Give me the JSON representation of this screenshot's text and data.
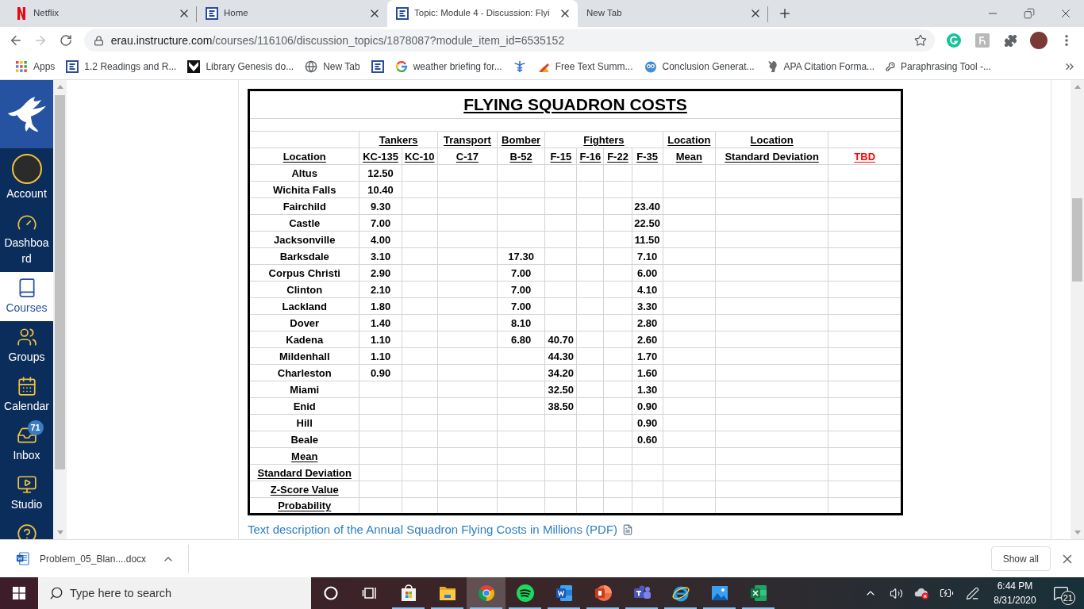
{
  "browser": {
    "tabs": [
      {
        "kind": "ribbon",
        "title": "Netflix",
        "selected": false
      },
      {
        "kind": "tile",
        "title": "Home",
        "selected": false
      },
      {
        "kind": "tile",
        "title": "Topic: Module 4 - Discussion: Flyi",
        "selected": true
      },
      {
        "kind": "blank",
        "title": "New Tab",
        "selected": false
      }
    ],
    "toolbar": {
      "back": {
        "disabled": false
      },
      "forward": {
        "disabled": true
      },
      "url_host": "erau.instructure.com",
      "url_path": "/courses/116106/discussion_topics/1878087?module_item_id=6535152"
    },
    "bookmarks": [
      {
        "kind": "apps",
        "label": "Apps"
      },
      {
        "kind": "tile",
        "label": "1.2 Readings and R..."
      },
      {
        "kind": "notch",
        "label": "Library Genesis do..."
      },
      {
        "kind": "globe",
        "label": "New Tab"
      },
      {
        "kind": "tile"
      },
      {
        "kind": "ring",
        "label": "weather briefing for..."
      },
      {
        "kind": "staff"
      },
      {
        "kind": "pencil",
        "label": "Free Text Summ..."
      },
      {
        "kind": "owl",
        "label": "Conclusion Generat..."
      },
      {
        "kind": "squirrel",
        "label": "APA Citation Forma..."
      },
      {
        "kind": "key",
        "label": "Paraphrasing Tool -..."
      }
    ]
  },
  "sidebar": {
    "items": [
      {
        "kind": "account",
        "label": "Account",
        "selected": false
      },
      {
        "kind": "dashboard",
        "label": "Dashboard",
        "selected": false
      },
      {
        "kind": "courses",
        "label": "Courses",
        "selected": true
      },
      {
        "kind": "groups",
        "label": "Groups",
        "selected": false
      },
      {
        "kind": "calendar",
        "label": "Calendar",
        "selected": false
      },
      {
        "kind": "inbox",
        "label": "Inbox",
        "selected": false,
        "badge": "71"
      },
      {
        "kind": "studio",
        "label": "Studio",
        "selected": false
      },
      {
        "kind": "help",
        "selected": false
      }
    ]
  },
  "page": {
    "table": {
      "title": "FLYING SQUADRON COSTS",
      "column_groups": [
        {
          "columns": [
            {
              "label": "Location"
            }
          ]
        },
        {
          "label": "Tankers",
          "columns": [
            {
              "label": "KC-135"
            },
            {
              "label": "KC-10"
            }
          ]
        },
        {
          "label": "Transport",
          "columns": [
            {
              "label": "C-17"
            }
          ]
        },
        {
          "label": "Bomber",
          "columns": [
            {
              "label": "B-52"
            }
          ]
        },
        {
          "label": "Fighters",
          "columns": [
            {
              "label": "F-15"
            },
            {
              "label": "F-16"
            },
            {
              "label": "F-22"
            },
            {
              "label": "F-35"
            }
          ]
        },
        {
          "label": "Location",
          "columns": [
            {
              "label": "Mean"
            }
          ]
        },
        {
          "label": "Location",
          "columns": [
            {
              "label": "Standard Deviation"
            }
          ]
        },
        {
          "columns": [
            {
              "label": "TBD",
              "color": "#ff0000"
            }
          ]
        }
      ],
      "rows": [
        {
          "location": "Altus",
          "kc_135": "12.50"
        },
        {
          "location": "Wichita Falls",
          "kc_135": "10.40"
        },
        {
          "location": "Fairchild",
          "kc_135": "9.30",
          "f_35": "23.40"
        },
        {
          "location": "Castle",
          "kc_135": "7.00",
          "f_35": "22.50"
        },
        {
          "location": "Jacksonville",
          "kc_135": "4.00",
          "f_35": "11.50"
        },
        {
          "location": "Barksdale",
          "kc_135": "3.10",
          "b_52": "17.30",
          "f_35": "7.10"
        },
        {
          "location": "Corpus Christi",
          "kc_135": "2.90",
          "b_52": "7.00",
          "f_35": "6.00"
        },
        {
          "location": "Clinton",
          "kc_135": "2.10",
          "b_52": "7.00",
          "f_35": "4.10"
        },
        {
          "location": "Lackland",
          "kc_135": "1.80",
          "b_52": "7.00",
          "f_35": "3.30"
        },
        {
          "location": "Dover",
          "kc_135": "1.40",
          "b_52": "8.10",
          "f_35": "2.80"
        },
        {
          "location": "Kadena",
          "kc_135": "1.10",
          "b_52": "6.80",
          "f_15": "40.70",
          "f_35": "2.60"
        },
        {
          "location": "Mildenhall",
          "kc_135": "1.10",
          "f_15": "44.30",
          "f_35": "1.70"
        },
        {
          "location": "Charleston",
          "kc_135": "0.90",
          "f_15": "34.20",
          "f_35": "1.60"
        },
        {
          "location": "Miami",
          "f_15": "32.50",
          "f_35": "1.30"
        },
        {
          "location": "Enid",
          "f_15": "38.50",
          "f_35": "0.90"
        },
        {
          "location": "Hill",
          "f_35": "0.90"
        },
        {
          "location": "Beale",
          "f_35": "0.60"
        }
      ],
      "summary_rows": [
        "Mean",
        "Standard Deviation",
        "Z-Score Value",
        "Probability"
      ]
    },
    "link": "Text description of the Annual Squadron Flying Costs in Millions (PDF)"
  },
  "downloads": {
    "items": [
      {
        "kind": "word",
        "name": "Problem_05_Blan....docx"
      }
    ],
    "show_all": "Show all"
  },
  "taskbar": {
    "search": {
      "placeholder": "Type here to search"
    },
    "apps": [
      {
        "kind": "ring",
        "running": false,
        "selected": false
      },
      {
        "kind": "taskview",
        "running": false,
        "selected": false
      },
      {
        "kind": "store",
        "running": true,
        "selected": false
      },
      {
        "kind": "folder",
        "running": true,
        "selected": false
      },
      {
        "kind": "wheel",
        "running": true,
        "selected": true
      },
      {
        "kind": "waves",
        "running": true,
        "selected": false
      },
      {
        "kind": "word",
        "running": true,
        "selected": false
      },
      {
        "kind": "slides",
        "running": true,
        "selected": false
      },
      {
        "kind": "people",
        "running": true,
        "selected": false
      },
      {
        "kind": "orbit",
        "running": true,
        "selected": false
      },
      {
        "kind": "photos",
        "running": true,
        "selected": false
      },
      {
        "kind": "sheet",
        "running": true,
        "selected": false
      }
    ],
    "time": "6:44 PM",
    "date": "8/31/2020",
    "notifications": "21"
  }
}
